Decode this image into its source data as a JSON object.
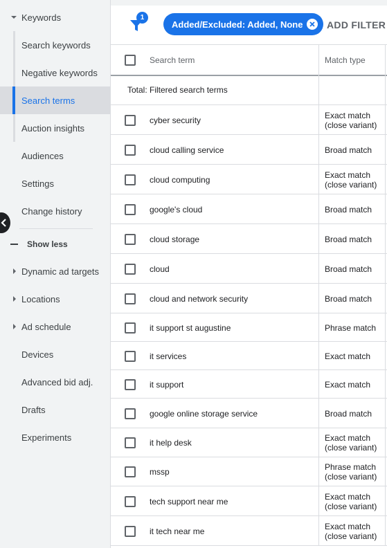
{
  "sidebar": {
    "keywords_label": "Keywords",
    "items": [
      {
        "label": "Search keywords"
      },
      {
        "label": "Negative keywords"
      },
      {
        "label": "Search terms"
      },
      {
        "label": "Auction insights"
      }
    ],
    "audiences": "Audiences",
    "settings": "Settings",
    "change_history": "Change history",
    "show_less": "Show less",
    "dynamic_ad_targets": "Dynamic ad targets",
    "locations": "Locations",
    "ad_schedule": "Ad schedule",
    "devices": "Devices",
    "advanced_bid_adj": "Advanced bid adj.",
    "drafts": "Drafts",
    "experiments": "Experiments"
  },
  "filterbar": {
    "filter_count": "1",
    "chip_label": "Added/Excluded: Added, None",
    "add_filter": "ADD FILTER"
  },
  "table": {
    "headers": {
      "term": "Search term",
      "match": "Match type"
    },
    "total_label": "Total: Filtered search terms",
    "rows": [
      {
        "term": "cyber security",
        "match1": "Exact match",
        "match2": "(close variant)"
      },
      {
        "term": "cloud calling service",
        "match1": "Broad match",
        "match2": ""
      },
      {
        "term": "cloud computing",
        "match1": "Exact match",
        "match2": "(close variant)"
      },
      {
        "term": "google's cloud",
        "match1": "Broad match",
        "match2": ""
      },
      {
        "term": "cloud storage",
        "match1": "Broad match",
        "match2": ""
      },
      {
        "term": "cloud",
        "match1": "Broad match",
        "match2": ""
      },
      {
        "term": "cloud and network security",
        "match1": "Broad match",
        "match2": ""
      },
      {
        "term": "it support st augustine",
        "match1": "Phrase match",
        "match2": ""
      },
      {
        "term": "it services",
        "match1": "Exact match",
        "match2": ""
      },
      {
        "term": "it support",
        "match1": "Exact match",
        "match2": ""
      },
      {
        "term": "google online storage service",
        "match1": "Broad match",
        "match2": ""
      },
      {
        "term": "it help desk",
        "match1": "Exact match",
        "match2": "(close variant)"
      },
      {
        "term": "mssp",
        "match1": "Phrase match",
        "match2": "(close variant)"
      },
      {
        "term": "tech support near me",
        "match1": "Exact match",
        "match2": "(close variant)"
      },
      {
        "term": "it tech near me",
        "match1": "Exact match",
        "match2": "(close variant)"
      }
    ]
  }
}
